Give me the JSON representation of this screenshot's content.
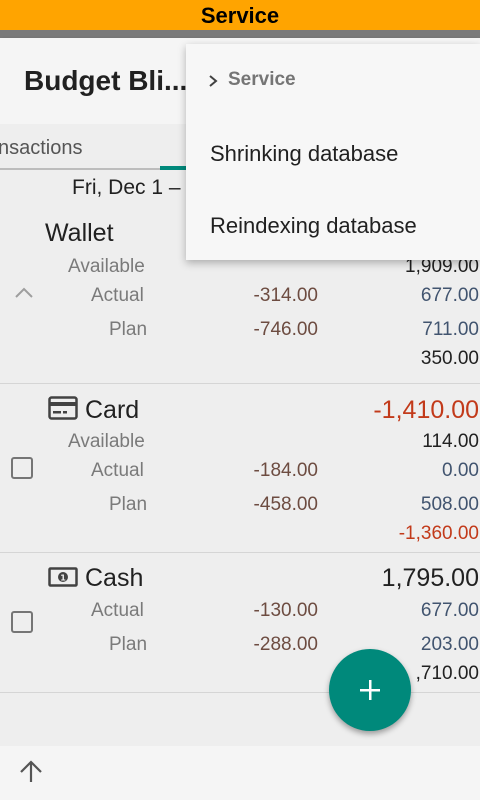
{
  "status_banner": "Service",
  "app": {
    "title": "Budget Bli..."
  },
  "tabs": {
    "active_partial_label": "nsactions"
  },
  "period": {
    "label": "Fri, Dec 1 –"
  },
  "accounts": [
    {
      "name": "Wallet",
      "available_label": "Available",
      "available": "1,909.00",
      "actual_label": "Actual",
      "actual_spent": "-314.00",
      "actual_value": "677.00",
      "plan_label": "Plan",
      "plan_spent": "-746.00",
      "plan_value": "711.00",
      "plan_total": "350.00"
    },
    {
      "name": "Card",
      "balance": "-1,410.00",
      "available_label": "Available",
      "available": "114.00",
      "actual_label": "Actual",
      "actual_spent": "-184.00",
      "actual_value": "0.00",
      "plan_label": "Plan",
      "plan_spent": "-458.00",
      "plan_value": "508.00",
      "plan_total": "-1,360.00"
    },
    {
      "name": "Cash",
      "balance": "1,795.00",
      "actual_label": "Actual",
      "actual_spent": "-130.00",
      "actual_value": "677.00",
      "plan_label": "Plan",
      "plan_spent": "-288.00",
      "plan_value": "203.00",
      "plan_total": ",710.00"
    }
  ],
  "menu": {
    "header": "Service",
    "items": [
      "Shrinking database",
      "Reindexing database"
    ]
  },
  "colors": {
    "banner": "#ffa400",
    "accent": "#00897b",
    "negative_red": "#c23a1a",
    "value_blue": "#41546f",
    "spent_brown": "#6d4c41"
  },
  "icons": [
    "chevron-up-icon",
    "credit-card-icon",
    "cash-icon",
    "checkbox-icon",
    "chevron-right-icon",
    "plus-icon",
    "arrow-up-icon"
  ]
}
